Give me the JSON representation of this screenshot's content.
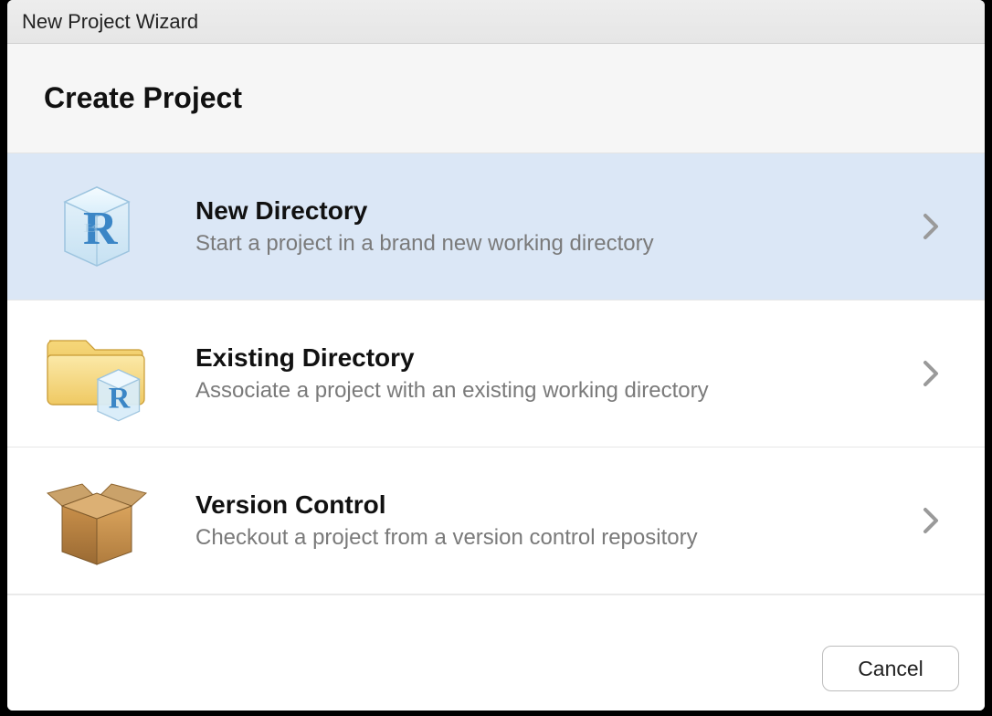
{
  "window": {
    "title": "New Project Wizard"
  },
  "header": {
    "title": "Create Project"
  },
  "options": [
    {
      "title": "New Directory",
      "subtitle": "Start a project in a brand new working directory",
      "selected": true,
      "icon": "r-cube-icon"
    },
    {
      "title": "Existing Directory",
      "subtitle": "Associate a project with an existing working directory",
      "selected": false,
      "icon": "folder-r-cube-icon"
    },
    {
      "title": "Version Control",
      "subtitle": "Checkout a project from a version control repository",
      "selected": false,
      "icon": "package-box-icon"
    }
  ],
  "footer": {
    "cancel_label": "Cancel"
  }
}
